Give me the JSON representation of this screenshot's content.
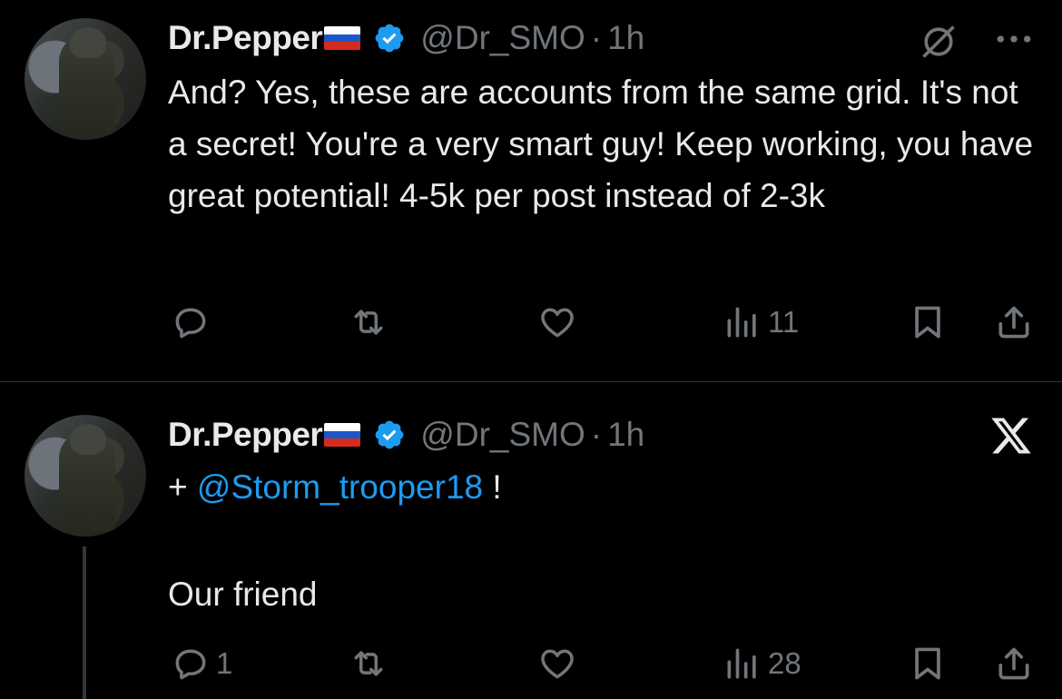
{
  "colors": {
    "background": "#000000",
    "text": "#e7e9ea",
    "secondary": "#71767b",
    "accent": "#1d9bf0",
    "divider": "#2f3336"
  },
  "tweets": [
    {
      "author_name": "Dr.Pepper",
      "flag": "russia-flag",
      "verified": true,
      "handle": "@Dr_SMO",
      "separator": "·",
      "time": "1h",
      "text": "And? Yes, these are accounts from the same grid. It's not a secret! You're a very smart guy! Keep working, you have great potential! 4-5k per post instead of 2-3k",
      "top_right_icons": [
        "grok-icon",
        "more-icon"
      ],
      "actions": {
        "reply_count": "",
        "repost_count": "",
        "like_count": "",
        "views_count": "11"
      }
    },
    {
      "author_name": "Dr.Pepper",
      "flag": "russia-flag",
      "verified": true,
      "handle": "@Dr_SMO",
      "separator": "·",
      "time": "1h",
      "text_prefix": "+ ",
      "mention": "@Storm_trooper18",
      "text_suffix": " !",
      "text_line2": "Our friend",
      "top_right_icons": [
        "x-logo-icon"
      ],
      "actions": {
        "reply_count": "1",
        "repost_count": "",
        "like_count": "",
        "views_count": "28"
      }
    }
  ]
}
